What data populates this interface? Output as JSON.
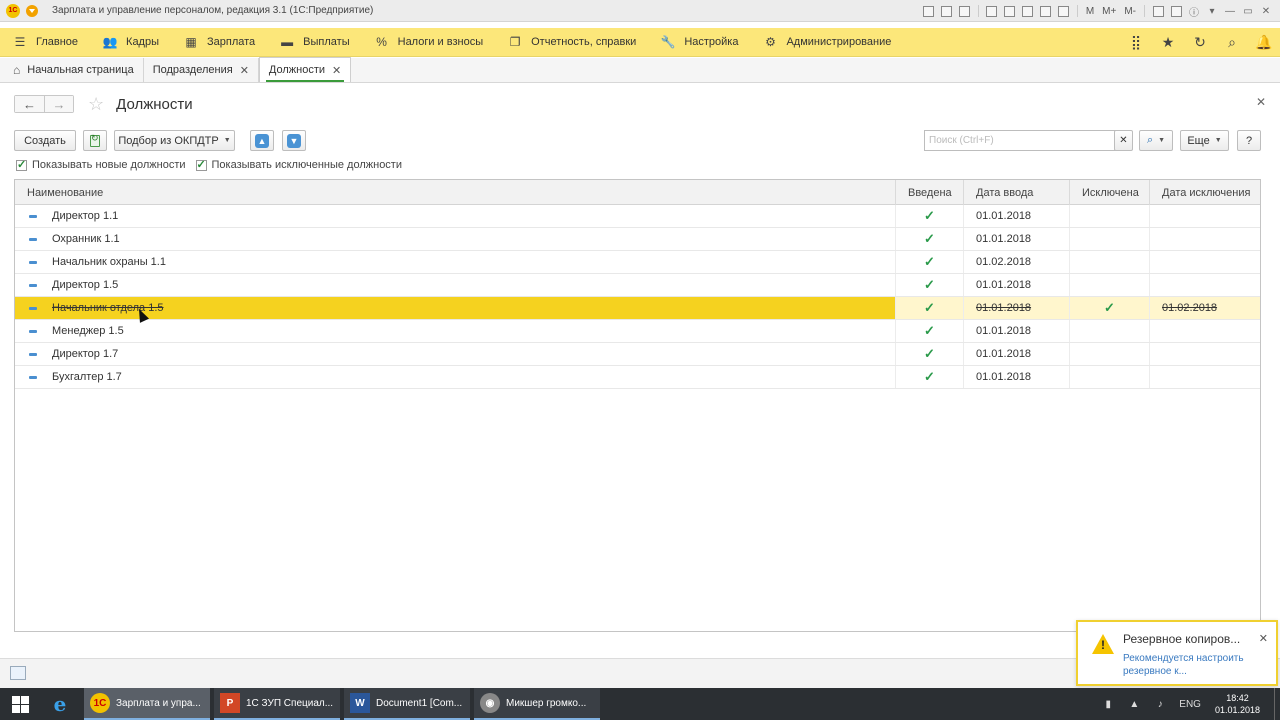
{
  "window": {
    "title": "Зарплата и управление персоналом, редакция 3.1  (1С:Предприятие)",
    "logo_text": "1C"
  },
  "titlebar_tools": {
    "m": "M",
    "mplus": "M+",
    "mminus": "M-"
  },
  "mainmenu": {
    "items": [
      {
        "label": "Главное",
        "icon": "menu-icon"
      },
      {
        "label": "Кадры",
        "icon": "people-icon"
      },
      {
        "label": "Зарплата",
        "icon": "calculator-icon"
      },
      {
        "label": "Выплаты",
        "icon": "wallet-icon"
      },
      {
        "label": "Налоги и взносы",
        "icon": "percent-icon"
      },
      {
        "label": "Отчетность, справки",
        "icon": "reports-icon"
      },
      {
        "label": "Настройка",
        "icon": "wrench-icon"
      },
      {
        "label": "Администрирование",
        "icon": "gear-icon"
      }
    ]
  },
  "tabs": [
    {
      "label": "Начальная страница"
    },
    {
      "label": "Подразделения"
    },
    {
      "label": "Должности"
    }
  ],
  "form": {
    "title": "Должности",
    "create_label": "Создать",
    "pick_label": "Подбор из ОКПДТР",
    "search_placeholder": "Поиск (Ctrl+F)",
    "more_label": "Еще",
    "help_label": "?",
    "show_new": "Показывать новые должности",
    "show_excluded": "Показывать исключенные должности"
  },
  "grid": {
    "columns": [
      "Наименование",
      "Введена",
      "Дата ввода",
      "Исключена",
      "Дата исключения"
    ],
    "rows": [
      {
        "name": "Директор 1.1",
        "introduced": "✓",
        "intro_date": "01.01.2018",
        "excluded": "",
        "excl_date": ""
      },
      {
        "name": "Охранник 1.1",
        "introduced": "✓",
        "intro_date": "01.01.2018",
        "excluded": "",
        "excl_date": ""
      },
      {
        "name": "Начальник охраны 1.1",
        "introduced": "✓",
        "intro_date": "01.02.2018",
        "excluded": "",
        "excl_date": ""
      },
      {
        "name": "Директор 1.5",
        "introduced": "✓",
        "intro_date": "01.01.2018",
        "excluded": "",
        "excl_date": ""
      },
      {
        "name": "Начальник отдела 1.5",
        "introduced": "✓",
        "intro_date": "01.01.2018",
        "excluded": "✓",
        "excl_date": "01.02.2018"
      },
      {
        "name": "Менеджер 1.5",
        "introduced": "✓",
        "intro_date": "01.01.2018",
        "excluded": "",
        "excl_date": ""
      },
      {
        "name": "Директор 1.7",
        "introduced": "✓",
        "intro_date": "01.01.2018",
        "excluded": "",
        "excl_date": ""
      },
      {
        "name": "Бухгалтер 1.7",
        "introduced": "✓",
        "intro_date": "01.01.2018",
        "excluded": "",
        "excl_date": ""
      }
    ]
  },
  "notification": {
    "title": "Резервное копиров...",
    "text": "Рекомендуется настроить резервное к..."
  },
  "taskbar": {
    "tasks": [
      {
        "label": "Зарплата и упра...",
        "icon": "1c-icon"
      },
      {
        "label": "1С ЗУП Специал...",
        "icon": "powerpoint-icon"
      },
      {
        "label": "Document1 [Com...",
        "icon": "word-icon"
      },
      {
        "label": "Микшер громко...",
        "icon": "mixer-icon"
      }
    ],
    "lang": "ENG",
    "time": "18:42",
    "date": "01.01.2018"
  },
  "colors": {
    "menu_bg": "#fce77a",
    "selected_row": "#f5d21f",
    "check": "#2a9a4a",
    "accent_tab": "#3a9b3a"
  }
}
